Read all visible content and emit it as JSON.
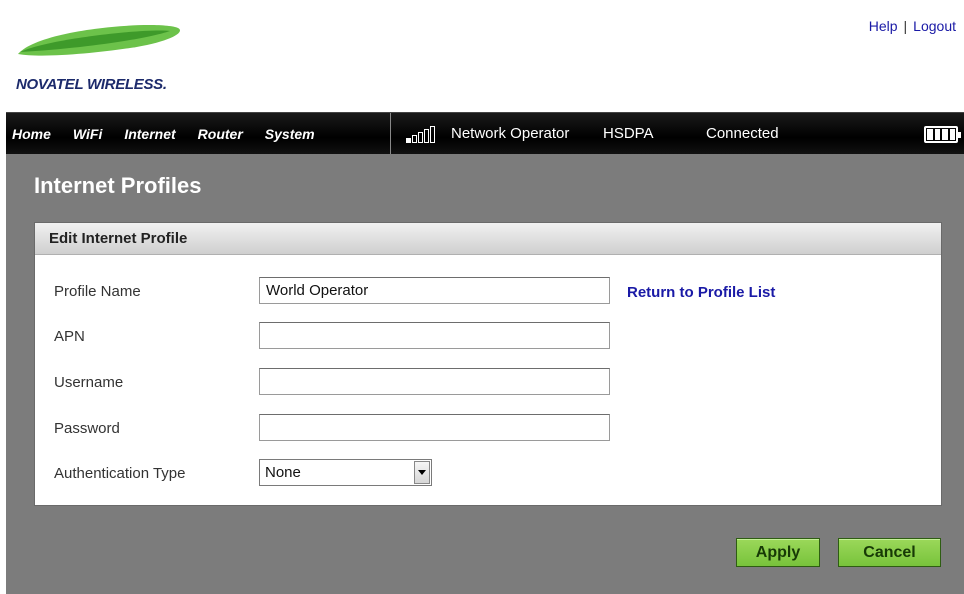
{
  "header": {
    "logo_text": "NOVATEL WIRELESS.",
    "help_label": "Help",
    "separator": "|",
    "logout_label": "Logout"
  },
  "nav": {
    "items": [
      {
        "label": "Home"
      },
      {
        "label": "WiFi"
      },
      {
        "label": "Internet"
      },
      {
        "label": "Router"
      },
      {
        "label": "System"
      }
    ],
    "network_operator": "Network Operator",
    "network_type": "HSDPA",
    "connection_status": "Connected",
    "signal_bars_filled": 1,
    "signal_bars_total": 5,
    "battery_level": 1.0
  },
  "page": {
    "title": "Internet Profiles"
  },
  "panel": {
    "title": "Edit Internet Profile",
    "return_link": "Return to Profile List",
    "fields": {
      "profile_name": {
        "label": "Profile Name",
        "value": "World Operator"
      },
      "apn": {
        "label": "APN",
        "value": ""
      },
      "username": {
        "label": "Username",
        "value": ""
      },
      "password": {
        "label": "Password",
        "value": ""
      },
      "auth_type": {
        "label": "Authentication Type",
        "value": "None"
      }
    }
  },
  "actions": {
    "apply_label": "Apply",
    "cancel_label": "Cancel"
  },
  "colors": {
    "content_bg": "#7c7c7c",
    "nav_bg": "#000000",
    "button_green": "#8acd4a",
    "link_blue": "#1a1aa6",
    "logo_green": "#5cb83a"
  }
}
